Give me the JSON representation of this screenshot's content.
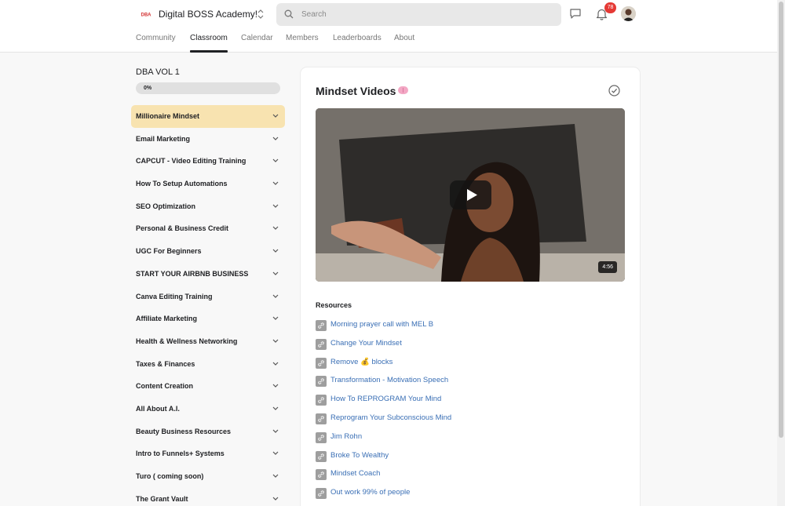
{
  "header": {
    "group_name": "Digital BOSS Academy!",
    "logo_text": "DBA",
    "search_placeholder": "Search",
    "notification_count": "78"
  },
  "nav": {
    "tabs": [
      {
        "label": "Community",
        "active": false
      },
      {
        "label": "Classroom",
        "active": true
      },
      {
        "label": "Calendar",
        "active": false
      },
      {
        "label": "Members",
        "active": false
      },
      {
        "label": "Leaderboards",
        "active": false
      },
      {
        "label": "About",
        "active": false
      }
    ]
  },
  "course": {
    "title": "DBA VOL 1",
    "progress_label": "0%",
    "progress_fraction": 0,
    "modules": [
      {
        "label": "Millionaire Mindset",
        "active": true
      },
      {
        "label": "Email Marketing",
        "active": false
      },
      {
        "label": "CAPCUT - Video Editing Training",
        "active": false
      },
      {
        "label": "How To Setup Automations",
        "active": false
      },
      {
        "label": "SEO Optimization",
        "active": false
      },
      {
        "label": "Personal & Business Credit",
        "active": false
      },
      {
        "label": "UGC For Beginners",
        "active": false
      },
      {
        "label": "START YOUR AIRBNB BUSINESS",
        "active": false
      },
      {
        "label": "Canva Editing Training",
        "active": false
      },
      {
        "label": "Affiliate Marketing",
        "active": false
      },
      {
        "label": "Health & Wellness Networking",
        "active": false
      },
      {
        "label": "Taxes & Finances",
        "active": false
      },
      {
        "label": "Content Creation",
        "active": false
      },
      {
        "label": "All About A.I.",
        "active": false
      },
      {
        "label": "Beauty Business Resources",
        "active": false
      },
      {
        "label": "Intro to Funnels+ Systems",
        "active": false
      },
      {
        "label": "Turo ( coming soon)",
        "active": false
      },
      {
        "label": "The Grant Vault",
        "active": false
      }
    ]
  },
  "lesson": {
    "title": "Mindset Videos",
    "video_duration": "4:56",
    "resources_heading": "Resources",
    "resources": [
      "Morning prayer call with MEL B",
      "Change Your Mindset",
      "Remove 💰 blocks",
      "Transformation - Motivation Speech",
      "How To REPROGRAM Your Mind",
      "Reprogram Your Subconscious Mind",
      "Jim Rohn",
      "Broke To Wealthy",
      "Mindset Coach",
      "Out work 99% of people"
    ]
  },
  "colors": {
    "accent": "#f8e3b0",
    "progress_fill": "#f8d46a",
    "link": "#3a6fb5",
    "badge": "#e53935"
  }
}
